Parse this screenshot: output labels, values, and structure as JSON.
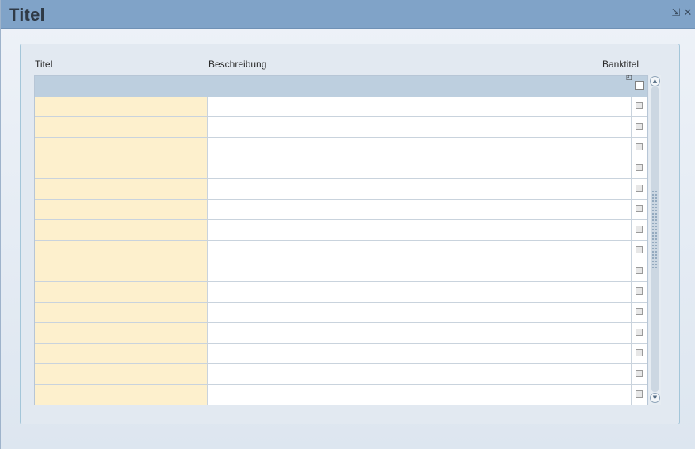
{
  "window": {
    "title": "Titel",
    "minimize_icon": "minimize-icon",
    "close_icon": "close-icon",
    "minimize_glyph": "⇲",
    "close_glyph": "✕"
  },
  "table": {
    "columns": [
      "Titel",
      "Beschreibung",
      "Banktitel"
    ],
    "header_checkbox_checked": false,
    "rows": [
      {
        "titel": "",
        "beschreibung": "",
        "banktitel": false
      },
      {
        "titel": "",
        "beschreibung": "",
        "banktitel": false
      },
      {
        "titel": "",
        "beschreibung": "",
        "banktitel": false
      },
      {
        "titel": "",
        "beschreibung": "",
        "banktitel": false
      },
      {
        "titel": "",
        "beschreibung": "",
        "banktitel": false
      },
      {
        "titel": "",
        "beschreibung": "",
        "banktitel": false
      },
      {
        "titel": "",
        "beschreibung": "",
        "banktitel": false
      },
      {
        "titel": "",
        "beschreibung": "",
        "banktitel": false
      },
      {
        "titel": "",
        "beschreibung": "",
        "banktitel": false
      },
      {
        "titel": "",
        "beschreibung": "",
        "banktitel": false
      },
      {
        "titel": "",
        "beschreibung": "",
        "banktitel": false
      },
      {
        "titel": "",
        "beschreibung": "",
        "banktitel": false
      },
      {
        "titel": "",
        "beschreibung": "",
        "banktitel": false
      },
      {
        "titel": "",
        "beschreibung": "",
        "banktitel": false
      },
      {
        "titel": "",
        "beschreibung": "",
        "banktitel": false
      }
    ]
  },
  "colors": {
    "titlebar": "#80a3c8",
    "header_row": "#bdcfdf",
    "required_cell": "#fdf0cd"
  }
}
